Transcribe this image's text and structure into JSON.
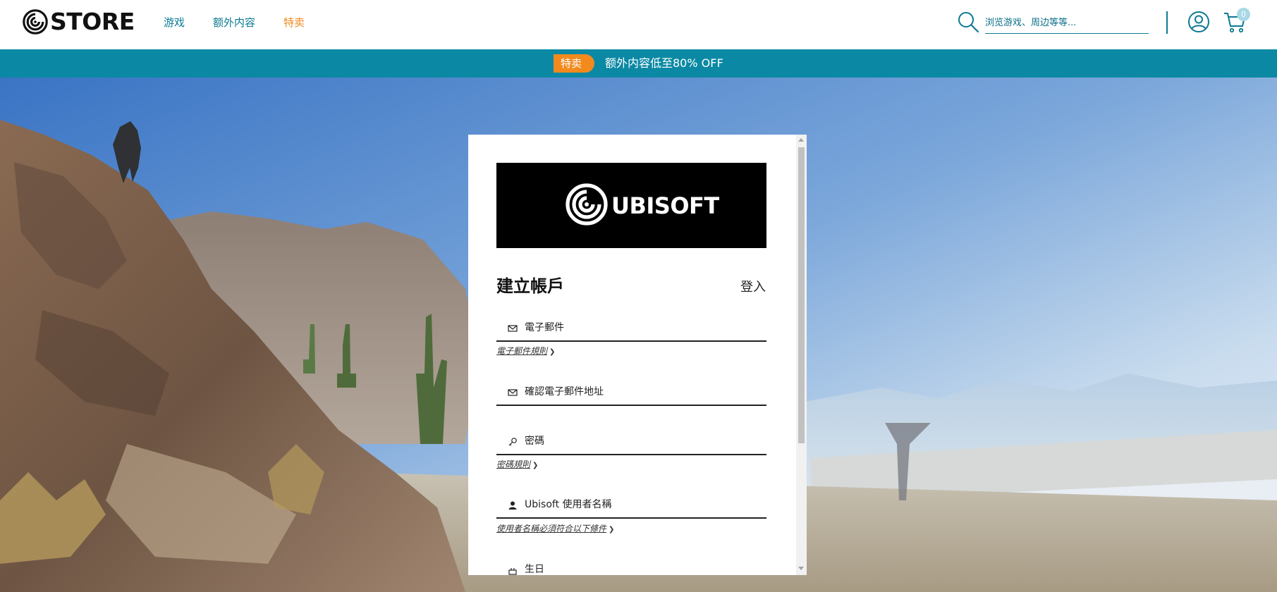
{
  "header": {
    "logo_text": "STORE",
    "nav": [
      {
        "label": "游戏"
      },
      {
        "label": "额外内容"
      },
      {
        "label": "特卖"
      }
    ],
    "search": {
      "placeholder": "浏览游戏、周边等等..."
    },
    "cart_count": "0"
  },
  "promo": {
    "tag": "特卖",
    "text": "额外内容低至80% OFF"
  },
  "dialog": {
    "brand": "UBISOFT",
    "title": "建立帳戶",
    "login_label": "登入",
    "fields": {
      "email": {
        "placeholder": "電子郵件",
        "value": ""
      },
      "confirm_email": {
        "placeholder": "確認電子郵件地址",
        "value": ""
      },
      "password": {
        "placeholder": "密碼",
        "value": ""
      },
      "username": {
        "placeholder": "Ubisoft 使用者名稱",
        "value": ""
      },
      "birthday": {
        "placeholder": "生日",
        "value": ""
      }
    },
    "rules": {
      "email_rules": "電子郵件規則",
      "password_rules": "密碼規則",
      "username_rules": "使用者名稱必須符合以下條件"
    }
  },
  "colors": {
    "accent": "#0b89a4",
    "link": "#0b7a93",
    "sale": "#f28a1e"
  }
}
